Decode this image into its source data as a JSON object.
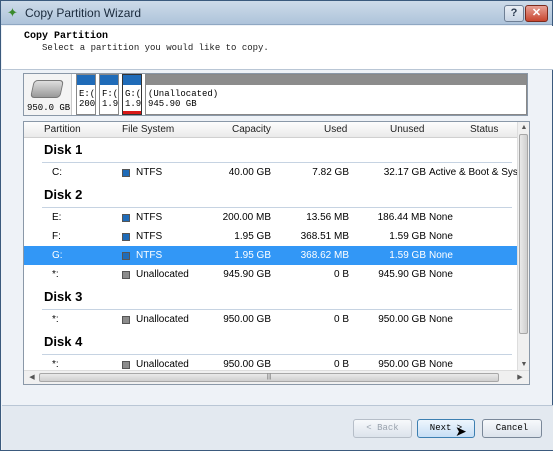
{
  "window": {
    "title": "Copy Partition Wizard",
    "help": "?",
    "close": "✕"
  },
  "header": {
    "title": "Copy Partition",
    "subtitle": "Select a partition you would like to copy."
  },
  "diskmap": {
    "disk_size": "950.0 GB",
    "blocks": [
      {
        "line1": "E:(",
        "line2": "200"
      },
      {
        "line1": "F:(",
        "line2": "1.9"
      },
      {
        "line1": "G:(",
        "line2": "1.9"
      },
      {
        "line1": "(Unallocated)",
        "line2": "945.90 GB"
      }
    ]
  },
  "table": {
    "headers": {
      "partition": "Partition",
      "filesystem": "File System",
      "capacity": "Capacity",
      "used": "Used",
      "unused": "Unused",
      "status": "Status"
    },
    "disks": [
      {
        "label": "Disk 1",
        "rows": [
          {
            "partition": "C:",
            "fs": "NTFS",
            "capacity": "40.00 GB",
            "used": "7.82 GB",
            "unused": "32.17 GB",
            "status": "Active & Boot & Sys"
          }
        ]
      },
      {
        "label": "Disk 2",
        "rows": [
          {
            "partition": "E:",
            "fs": "NTFS",
            "capacity": "200.00 MB",
            "used": "13.56 MB",
            "unused": "186.44 MB",
            "status": "None"
          },
          {
            "partition": "F:",
            "fs": "NTFS",
            "capacity": "1.95 GB",
            "used": "368.51 MB",
            "unused": "1.59 GB",
            "status": "None"
          },
          {
            "partition": "G:",
            "fs": "NTFS",
            "capacity": "1.95 GB",
            "used": "368.62 MB",
            "unused": "1.59 GB",
            "status": "None"
          },
          {
            "partition": "*:",
            "fs": "Unallocated",
            "capacity": "945.90 GB",
            "used": "0 B",
            "unused": "945.90 GB",
            "status": "None"
          }
        ]
      },
      {
        "label": "Disk 3",
        "rows": [
          {
            "partition": "*:",
            "fs": "Unallocated",
            "capacity": "950.00 GB",
            "used": "0 B",
            "unused": "950.00 GB",
            "status": "None"
          }
        ]
      },
      {
        "label": "Disk 4",
        "rows": [
          {
            "partition": "*:",
            "fs": "Unallocated",
            "capacity": "950.00 GB",
            "used": "0 B",
            "unused": "950.00 GB",
            "status": "None"
          }
        ]
      }
    ],
    "selected": "G:"
  },
  "footer": {
    "back": "< Back",
    "next": "Next >",
    "cancel": "Cancel"
  },
  "colors": {
    "ntfs": "#1f6bb8",
    "unallocated": "#8c8c8c",
    "selection": "#3297f6"
  }
}
